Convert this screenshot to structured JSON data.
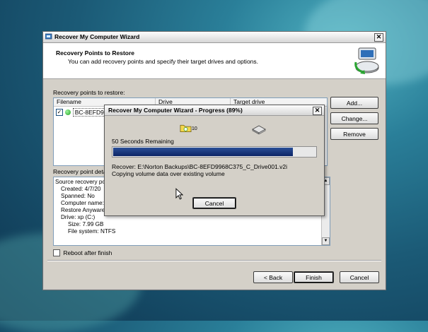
{
  "wizard": {
    "title": "Recover My Computer Wizard",
    "header_title": "Recovery Points to Restore",
    "header_subtitle": "You can add recovery points and specify their target drives and options.",
    "list_label": "Recovery points to restore:",
    "columns": [
      "Filename",
      "Drive",
      "Target drive"
    ],
    "row_filename": "BC-8EFD99",
    "details_label": "Recovery point detai",
    "details_lines": [
      "Source recovery poi",
      "Created:  4/7/20",
      "Spanned:  No",
      "Computer name:",
      "Restore Anyware",
      "Drive:  xp (C:)",
      "Size:  7.99 GB",
      "File system:  NTFS"
    ],
    "buttons": {
      "add": "Add...",
      "change": "Change...",
      "remove": "Remove"
    },
    "reboot_label": "Reboot after finish",
    "nav": {
      "back": "< Back",
      "finish": "Finish",
      "cancel": "Cancel"
    },
    "close_glyph": "✕"
  },
  "progress_dialog": {
    "title": "Recover My Computer Wizard - Progress  (89%)",
    "icon_count": "10",
    "remaining": "50 Seconds Remaining",
    "progress": 0.89,
    "recover_line": "Recover: E:\\Norton Backups\\BC-8EFD9968C375_C_Drive001.v2i",
    "status_line": "Copying volume data over existing volume",
    "cancel_label": "Cancel",
    "close_glyph": "✕"
  }
}
